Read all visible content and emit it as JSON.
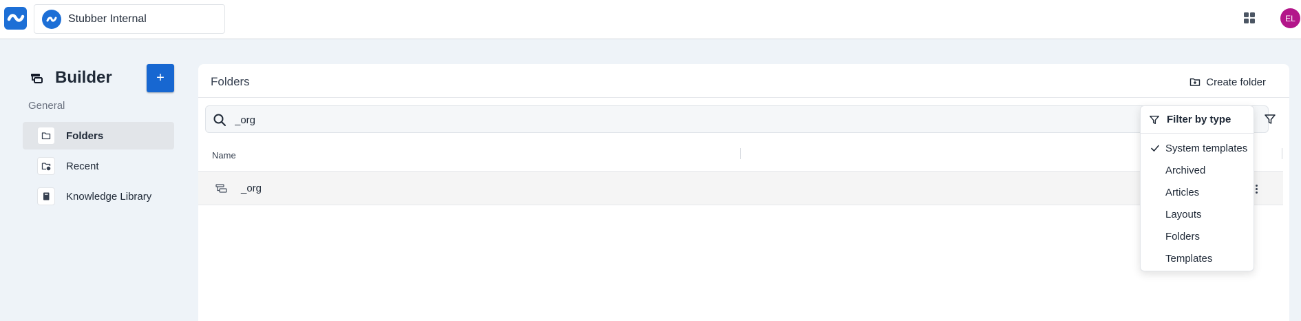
{
  "header": {
    "org_name": "Stubber Internal",
    "avatar_initials": "EL"
  },
  "sidebar": {
    "title": "Builder",
    "add_label": "+",
    "section": "General",
    "items": [
      {
        "label": "Folders",
        "active": true
      },
      {
        "label": "Recent",
        "active": false
      },
      {
        "label": "Knowledge Library",
        "active": false
      }
    ]
  },
  "main": {
    "title": "Folders",
    "create_folder_label": "Create folder",
    "search": {
      "value": "_org"
    },
    "columns": [
      "Name"
    ],
    "rows": [
      {
        "name": "_org"
      }
    ]
  },
  "filter_menu": {
    "title": "Filter by type",
    "options": [
      {
        "label": "System templates",
        "checked": true
      },
      {
        "label": "Archived",
        "checked": false
      },
      {
        "label": "Articles",
        "checked": false
      },
      {
        "label": "Layouts",
        "checked": false
      },
      {
        "label": "Folders",
        "checked": false
      },
      {
        "label": "Templates",
        "checked": false
      }
    ]
  },
  "colors": {
    "brand_blue": "#1d6fd6",
    "primary_button": "#1767d1",
    "avatar_bg": "#b3158a",
    "page_bg": "#eef3f8"
  }
}
